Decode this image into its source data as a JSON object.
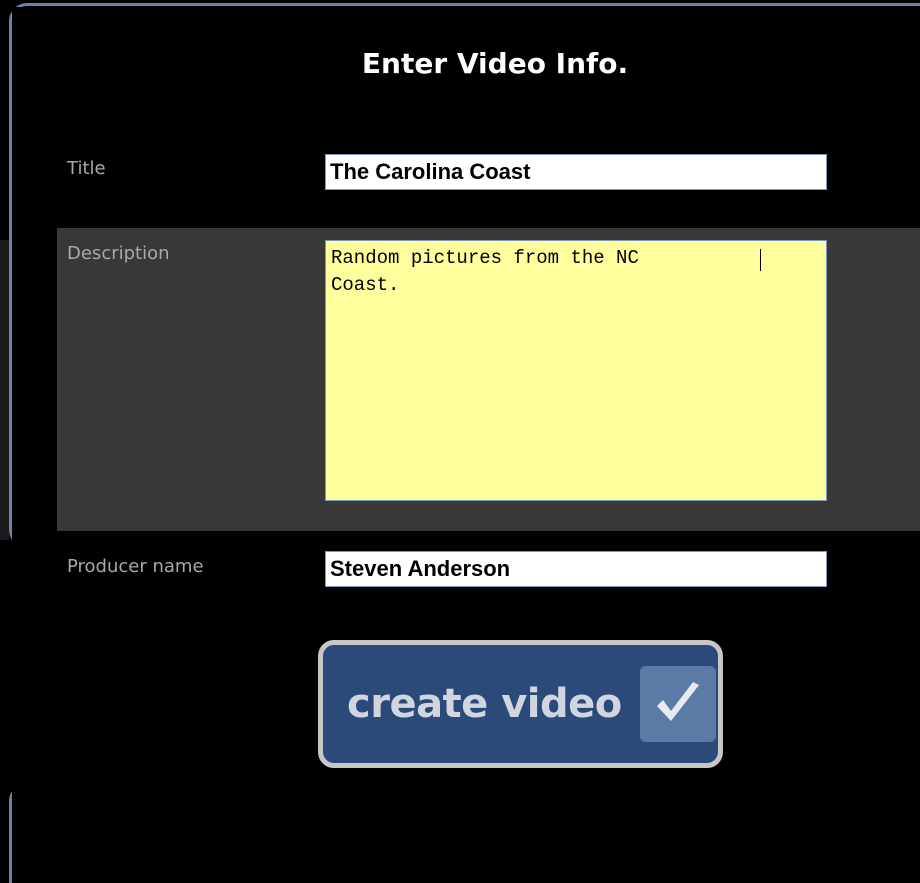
{
  "dialog": {
    "heading": "Enter Video Info."
  },
  "form": {
    "title_label": "Title",
    "title_value": "The Carolina Coast",
    "description_label": "Description",
    "description_value": "Random pictures from the NC\nCoast.",
    "producer_label": "Producer name",
    "producer_value": "Steven Anderson"
  },
  "actions": {
    "create_label": "create video",
    "create_icon": "checkmark-icon"
  },
  "colors": {
    "accent": "#2b4a7a",
    "frame": "#6b84a5",
    "textarea_bg": "#ffff9e"
  }
}
